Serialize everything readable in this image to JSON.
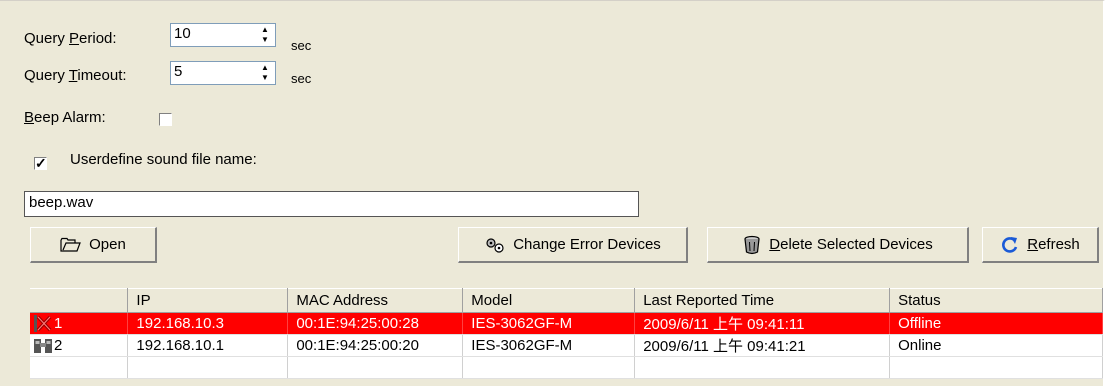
{
  "query_period": {
    "label_before": "Query ",
    "label_key": "P",
    "label_after": "eriod:",
    "value": "10",
    "unit": "sec"
  },
  "query_timeout": {
    "label_before": "Query ",
    "label_key": "T",
    "label_after": "imeout:",
    "value": "5",
    "unit": "sec"
  },
  "beep_alarm": {
    "label_key": "B",
    "label_after": "eep Alarm:",
    "checked": false
  },
  "userdefine": {
    "label": "Userdefine sound file name:",
    "checked": true
  },
  "sound_file": {
    "value": "beep.wav"
  },
  "buttons": {
    "open": "Open",
    "change_error": "Change Error Devices",
    "delete_key": "D",
    "delete_rest": "elete Selected Devices",
    "refresh_key": "R",
    "refresh_rest": "efresh"
  },
  "table": {
    "columns": [
      "",
      "IP",
      "MAC Address",
      "Model",
      "Last Reported Time",
      "Status"
    ],
    "rows": [
      {
        "index": "1",
        "icon": "offline-x-icon",
        "ip": "192.168.10.3",
        "mac": "00:1E:94:25:00:28",
        "model": "IES-3062GF-M",
        "time": "2009/6/11 上午 09:41:11",
        "status": "Offline"
      },
      {
        "index": "2",
        "icon": "online-device-icon",
        "ip": "192.168.10.1",
        "mac": "00:1E:94:25:00:20",
        "model": "IES-3062GF-M",
        "time": "2009/6/11 上午 09:41:21",
        "status": "Online"
      }
    ]
  },
  "colors": {
    "offline_row": "#ff0000",
    "panel": "#ece9d8"
  }
}
